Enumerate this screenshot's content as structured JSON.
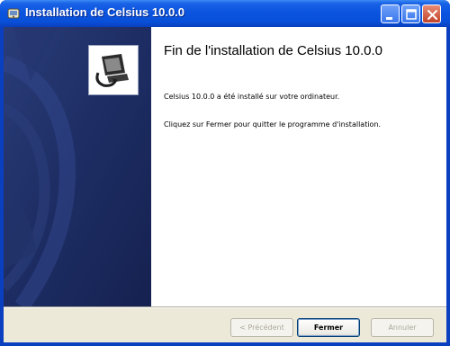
{
  "window": {
    "title": "Installation de Celsius 10.0.0",
    "icon": "installer-icon"
  },
  "titlebar_buttons": {
    "minimize_icon": "minimize-icon",
    "maximize_icon": "maximize-icon",
    "close_icon": "close-icon"
  },
  "sidebar": {
    "logo_icon": "computer-install-icon"
  },
  "main": {
    "heading": "Fin de l'installation de Celsius 10.0.0",
    "message_installed": "Celsius 10.0.0 a été installé sur votre ordinateur.",
    "message_instructions": "Cliquez sur Fermer pour quitter le programme d'installation."
  },
  "buttons": {
    "previous_label": "< Précédent",
    "close_label": "Fermer",
    "cancel_label": "Annuler"
  },
  "colors": {
    "titlebar_blue": "#0b54e0",
    "sidebar_navy": "#1b2a5c",
    "dialog_face": "#ece9d8"
  }
}
